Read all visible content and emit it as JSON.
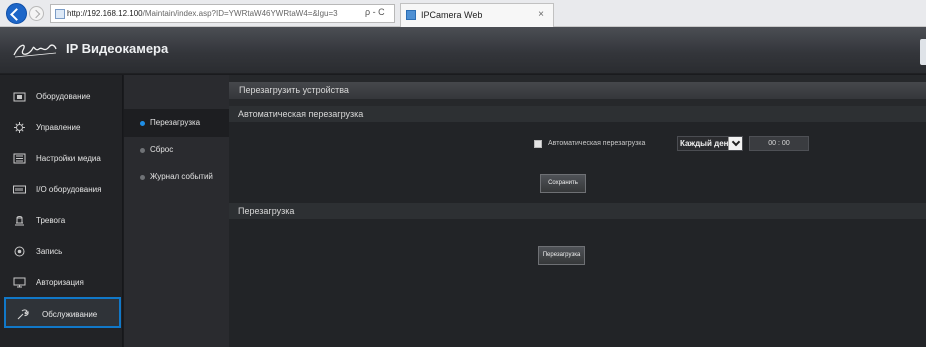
{
  "browser": {
    "url_host": "http://192.168.12.100",
    "url_path": "/Maintain/index.asp?ID=YWRtaW46YWRtaW4=&lgu=3",
    "address_actions": "ρ - C",
    "tab_title": "IPCamera Web",
    "tab_close": "×",
    "accent_color": "#1d66c8"
  },
  "app": {
    "title": "IP Видеокамера",
    "logo_icon": "brand-signature-logo"
  },
  "sidebar": {
    "items": [
      {
        "label": "Оборудование",
        "icon": "camera-icon"
      },
      {
        "label": "Управление",
        "icon": "gear-icon"
      },
      {
        "label": "Настройки медиа",
        "icon": "media-icon"
      },
      {
        "label": "I/O оборудования",
        "icon": "io-port-icon"
      },
      {
        "label": "Тревога",
        "icon": "alarm-icon"
      },
      {
        "label": "Запись",
        "icon": "record-icon"
      },
      {
        "label": "Авторизация",
        "icon": "monitor-icon"
      },
      {
        "label": "Обслуживание",
        "icon": "wrench-icon"
      }
    ],
    "active_index": 7,
    "active_border_color": "#1178c8"
  },
  "subnav": {
    "items": [
      {
        "label": "Перезагрузка"
      },
      {
        "label": "Сброс"
      },
      {
        "label": "Журнал событий"
      }
    ],
    "active_index": 0,
    "active_bullet_color": "#1e8ee7"
  },
  "main": {
    "panel_title": "Перезагрузить устройства",
    "auto_section": {
      "header": "Автоматическая перезагрузка",
      "checkbox_label": "Автоматическая перезагрузка",
      "checkbox_checked": false,
      "schedule_value": "Каждый день",
      "time_hours": "00",
      "time_separator": ":",
      "time_minutes": "00",
      "save_label": "Сохранить"
    },
    "reboot_section": {
      "header": "Перезагрузка",
      "reboot_label": "Перезагрузка"
    }
  }
}
